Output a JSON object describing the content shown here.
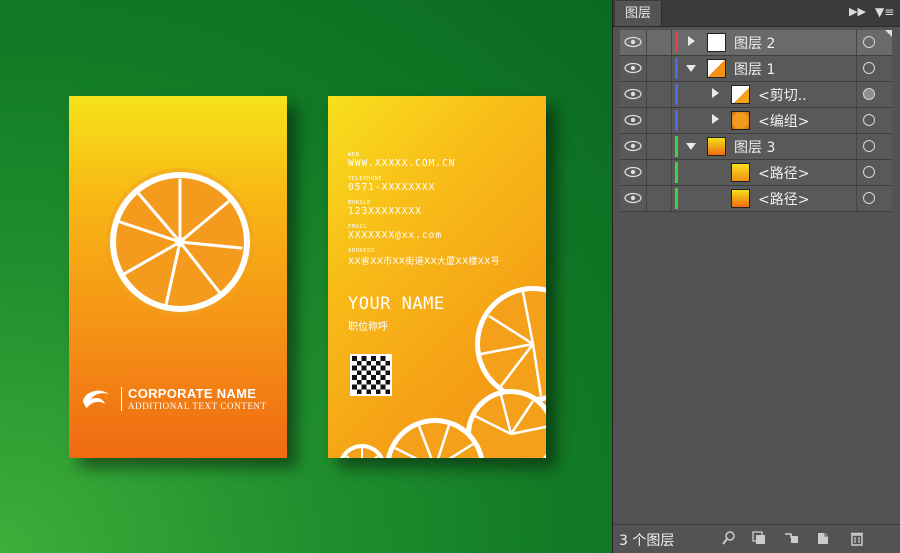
{
  "front": {
    "corp_name": "CORPORATE NAME",
    "corp_sub": "ADDITIONAL TEXT CONTENT"
  },
  "back": {
    "web_label": "WEB",
    "web": "WWW.XXXXX.COM.CN",
    "tel_label": "TELEPHONE",
    "tel": "0571-XXXXXXXX",
    "mobile_label": "MOBILE",
    "mobile": "123XXXXXXXX",
    "email_label": "EMAIL",
    "email": "XXXXXXX@xx.com",
    "address_label": "ADDRESS",
    "address": "XX省XX市XX街道XX大厦XX楼XX号",
    "name": "YOUR NAME",
    "title": "职位称呼"
  },
  "panel": {
    "tab_label": "图层",
    "layer_count": "3 个图层",
    "layers": [
      {
        "name": "图层 2",
        "color": "#e6414b",
        "arrow": "right",
        "indent": 0,
        "selected": true
      },
      {
        "name": "图层 1",
        "color": "#4a6bde",
        "arrow": "down",
        "indent": 0,
        "selected": false
      },
      {
        "name": "<剪切..",
        "color": "#4a6bde",
        "arrow": "right",
        "indent": 1,
        "selected": false
      },
      {
        "name": "<编组>",
        "color": "#4a6bde",
        "arrow": "right",
        "indent": 1,
        "selected": false
      },
      {
        "name": "图层 3",
        "color": "#3fd04a",
        "arrow": "down",
        "indent": 0,
        "selected": false
      },
      {
        "name": "<路径>",
        "color": "#3fd04a",
        "arrow": "none",
        "indent": 2,
        "selected": false
      },
      {
        "name": "<路径>",
        "color": "#3fd04a",
        "arrow": "none",
        "indent": 2,
        "selected": false
      }
    ]
  }
}
